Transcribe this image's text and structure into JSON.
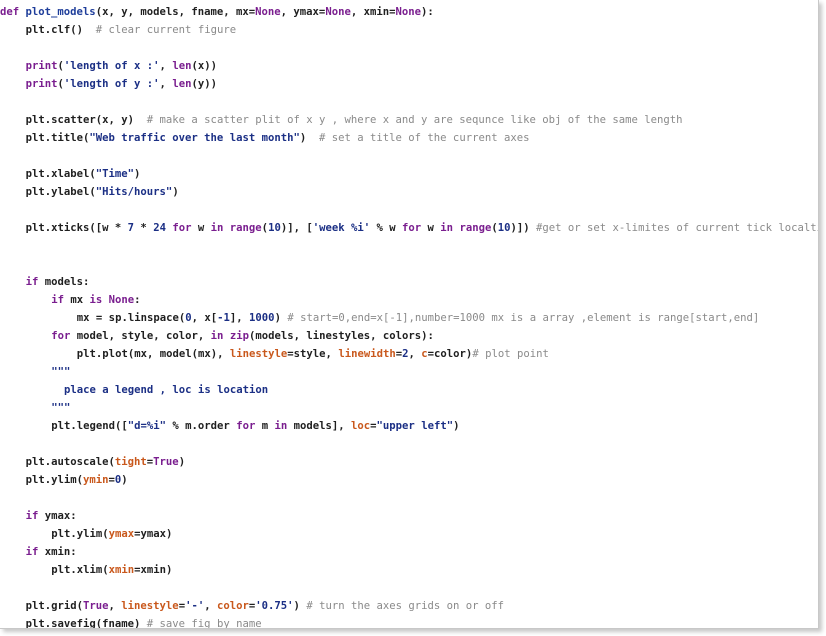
{
  "colors": {
    "keyword": "#7a1e8f",
    "function_name": "#1e3d9a",
    "string": "#1b2f85",
    "number": "#1b2f85",
    "parameter": "#c9581c",
    "comment": "#8a8a8a",
    "text": "#1f1f1f",
    "background": "#ffffff"
  },
  "code_lines": [
    {
      "indent": 0,
      "tokens": [
        [
          "kw",
          "def "
        ],
        [
          "fn",
          "plot_models"
        ],
        [
          "nm",
          "(x, y, models, fname, mx="
        ],
        [
          "kw",
          "None"
        ],
        [
          "nm",
          ", ymax="
        ],
        [
          "kw",
          "None"
        ],
        [
          "nm",
          ", xmin="
        ],
        [
          "kw",
          "None"
        ],
        [
          "nm",
          "):"
        ]
      ]
    },
    {
      "indent": 4,
      "tokens": [
        [
          "nm",
          "plt.clf()  "
        ],
        [
          "cm",
          "# clear current figure"
        ]
      ]
    },
    {
      "indent": 0,
      "tokens": []
    },
    {
      "indent": 4,
      "tokens": [
        [
          "bi",
          "print"
        ],
        [
          "nm",
          "("
        ],
        [
          "str",
          "'length of x :'"
        ],
        [
          "nm",
          ", "
        ],
        [
          "bi",
          "len"
        ],
        [
          "nm",
          "(x))"
        ]
      ]
    },
    {
      "indent": 4,
      "tokens": [
        [
          "bi",
          "print"
        ],
        [
          "nm",
          "("
        ],
        [
          "str",
          "'length of y :'"
        ],
        [
          "nm",
          ", "
        ],
        [
          "bi",
          "len"
        ],
        [
          "nm",
          "(y))"
        ]
      ]
    },
    {
      "indent": 0,
      "tokens": []
    },
    {
      "indent": 4,
      "tokens": [
        [
          "nm",
          "plt.scatter(x, y)  "
        ],
        [
          "cm",
          "# make a scatter plit of x y , where x and y are sequnce like obj of the same length"
        ]
      ]
    },
    {
      "indent": 4,
      "tokens": [
        [
          "nm",
          "plt.title("
        ],
        [
          "str",
          "\"Web traffic over the last month\""
        ],
        [
          "nm",
          ")  "
        ],
        [
          "cm",
          "# set a title of the current axes"
        ]
      ]
    },
    {
      "indent": 0,
      "tokens": []
    },
    {
      "indent": 4,
      "tokens": [
        [
          "nm",
          "plt.xlabel("
        ],
        [
          "str",
          "\"Time\""
        ],
        [
          "nm",
          ")"
        ]
      ]
    },
    {
      "indent": 4,
      "tokens": [
        [
          "nm",
          "plt.ylabel("
        ],
        [
          "str",
          "\"Hits/hours\""
        ],
        [
          "nm",
          ")"
        ]
      ]
    },
    {
      "indent": 0,
      "tokens": []
    },
    {
      "indent": 4,
      "tokens": [
        [
          "nm",
          "plt.xticks([w * "
        ],
        [
          "num",
          "7"
        ],
        [
          "nm",
          " * "
        ],
        [
          "num",
          "24"
        ],
        [
          "nm",
          " "
        ],
        [
          "kw",
          "for"
        ],
        [
          "nm",
          " w "
        ],
        [
          "kw",
          "in"
        ],
        [
          "nm",
          " "
        ],
        [
          "bi",
          "range"
        ],
        [
          "nm",
          "("
        ],
        [
          "num",
          "10"
        ],
        [
          "nm",
          ")], ["
        ],
        [
          "str",
          "'week %i'"
        ],
        [
          "nm",
          " % w "
        ],
        [
          "kw",
          "for"
        ],
        [
          "nm",
          " w "
        ],
        [
          "kw",
          "in"
        ],
        [
          "nm",
          " "
        ],
        [
          "bi",
          "range"
        ],
        [
          "nm",
          "("
        ],
        [
          "num",
          "10"
        ],
        [
          "nm",
          ")]) "
        ],
        [
          "cm",
          "#get or set x-limites of current tick localtion"
        ]
      ]
    },
    {
      "indent": 0,
      "tokens": []
    },
    {
      "indent": 0,
      "tokens": []
    },
    {
      "indent": 4,
      "tokens": [
        [
          "kw",
          "if"
        ],
        [
          "nm",
          " models:"
        ]
      ]
    },
    {
      "indent": 8,
      "tokens": [
        [
          "kw",
          "if"
        ],
        [
          "nm",
          " mx "
        ],
        [
          "kw",
          "is"
        ],
        [
          "nm",
          " "
        ],
        [
          "kw",
          "None"
        ],
        [
          "nm",
          ":"
        ]
      ]
    },
    {
      "indent": 12,
      "tokens": [
        [
          "nm",
          "mx = sp.linspace("
        ],
        [
          "num",
          "0"
        ],
        [
          "nm",
          ", x["
        ],
        [
          "num",
          "-1"
        ],
        [
          "nm",
          "], "
        ],
        [
          "num",
          "1000"
        ],
        [
          "nm",
          ") "
        ],
        [
          "cm",
          "# start=0,end=x[-1],number=1000 mx is a array ,element is range[start,end]"
        ]
      ]
    },
    {
      "indent": 8,
      "tokens": [
        [
          "kw",
          "for"
        ],
        [
          "nm",
          " model, style, color, "
        ],
        [
          "kw",
          "in"
        ],
        [
          "nm",
          " "
        ],
        [
          "bi",
          "zip"
        ],
        [
          "nm",
          "(models, linestyles, colors):"
        ]
      ]
    },
    {
      "indent": 12,
      "tokens": [
        [
          "nm",
          "plt.plot(mx, model(mx), "
        ],
        [
          "pm",
          "linestyle"
        ],
        [
          "nm",
          "=style, "
        ],
        [
          "pm",
          "linewidth"
        ],
        [
          "nm",
          "="
        ],
        [
          "num",
          "2"
        ],
        [
          "nm",
          ", "
        ],
        [
          "pm",
          "c"
        ],
        [
          "nm",
          "=color)"
        ],
        [
          "cm",
          "# plot point"
        ]
      ]
    },
    {
      "indent": 8,
      "tokens": [
        [
          "str",
          "\"\"\""
        ]
      ]
    },
    {
      "indent": 10,
      "tokens": [
        [
          "str",
          "place a legend , loc is location"
        ]
      ]
    },
    {
      "indent": 8,
      "tokens": [
        [
          "str",
          "\"\"\""
        ]
      ]
    },
    {
      "indent": 8,
      "tokens": [
        [
          "nm",
          "plt.legend(["
        ],
        [
          "str",
          "\"d=%i\""
        ],
        [
          "nm",
          " % m.order "
        ],
        [
          "kw",
          "for"
        ],
        [
          "nm",
          " m "
        ],
        [
          "kw",
          "in"
        ],
        [
          "nm",
          " models], "
        ],
        [
          "pm",
          "loc"
        ],
        [
          "nm",
          "="
        ],
        [
          "str",
          "\"upper left\""
        ],
        [
          "nm",
          ")"
        ]
      ]
    },
    {
      "indent": 0,
      "tokens": []
    },
    {
      "indent": 4,
      "tokens": [
        [
          "nm",
          "plt.autoscale("
        ],
        [
          "pm",
          "tight"
        ],
        [
          "nm",
          "="
        ],
        [
          "kw",
          "True"
        ],
        [
          "nm",
          ")"
        ]
      ]
    },
    {
      "indent": 4,
      "tokens": [
        [
          "nm",
          "plt.ylim("
        ],
        [
          "pm",
          "ymin"
        ],
        [
          "nm",
          "="
        ],
        [
          "num",
          "0"
        ],
        [
          "nm",
          ")"
        ]
      ]
    },
    {
      "indent": 0,
      "tokens": []
    },
    {
      "indent": 4,
      "tokens": [
        [
          "kw",
          "if"
        ],
        [
          "nm",
          " ymax:"
        ]
      ]
    },
    {
      "indent": 8,
      "tokens": [
        [
          "nm",
          "plt.ylim("
        ],
        [
          "pm",
          "ymax"
        ],
        [
          "nm",
          "=ymax)"
        ]
      ]
    },
    {
      "indent": 4,
      "tokens": [
        [
          "kw",
          "if"
        ],
        [
          "nm",
          " xmin:"
        ]
      ]
    },
    {
      "indent": 8,
      "tokens": [
        [
          "nm",
          "plt.xlim("
        ],
        [
          "pm",
          "xmin"
        ],
        [
          "nm",
          "=xmin)"
        ]
      ]
    },
    {
      "indent": 0,
      "tokens": []
    },
    {
      "indent": 4,
      "tokens": [
        [
          "nm",
          "plt.grid("
        ],
        [
          "kw",
          "True"
        ],
        [
          "nm",
          ", "
        ],
        [
          "pm",
          "linestyle"
        ],
        [
          "nm",
          "="
        ],
        [
          "str",
          "'-'"
        ],
        [
          "nm",
          ", "
        ],
        [
          "pm",
          "color"
        ],
        [
          "nm",
          "="
        ],
        [
          "str",
          "'0.75'"
        ],
        [
          "nm",
          ") "
        ],
        [
          "cm",
          "# turn the axes grids on or off"
        ]
      ]
    },
    {
      "indent": 4,
      "tokens": [
        [
          "nm",
          "plt.savefig(fname) "
        ],
        [
          "cm",
          "# save fig by name"
        ]
      ]
    }
  ]
}
